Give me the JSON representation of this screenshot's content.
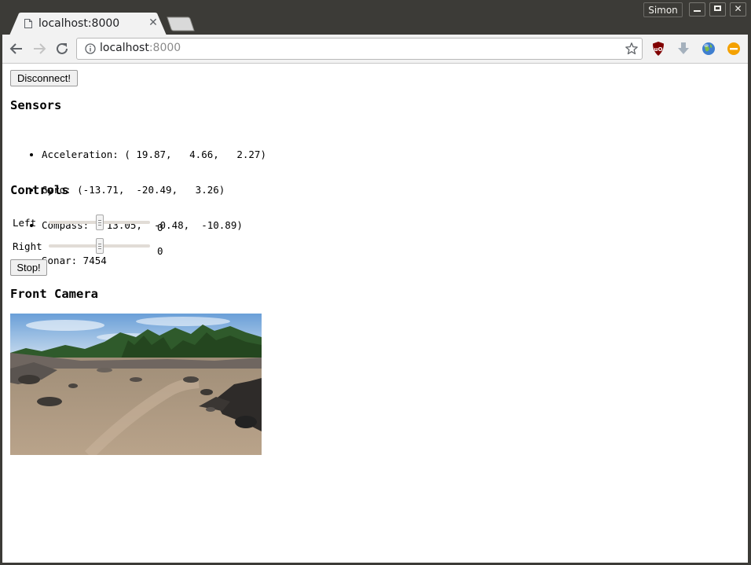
{
  "window": {
    "user_name": "Simon"
  },
  "tab": {
    "title": "localhost:8000"
  },
  "address_bar": {
    "host": "localhost",
    "port": ":8000"
  },
  "icons": {
    "tab_page": "page-icon",
    "tab_close": "close-icon",
    "back": "arrow-left-icon",
    "forward": "arrow-right-icon",
    "reload": "reload-icon",
    "site_info": "info-icon",
    "bookmark": "star-icon",
    "ublock": "ublock-shield-icon",
    "download": "download-arrow-icon",
    "globe": "globe-icon",
    "minus": "minus-circle-icon"
  },
  "page": {
    "disconnect_label": "Disconnect!",
    "sensors_heading": "Sensors",
    "sensors": [
      "Acceleration: ( 19.87,   4.66,   2.27)",
      "Gyro: (-13.71,  -20.49,   3.26)",
      "Compass: ( 13.05,  -0.48,  -10.89)",
      "Sonar: 7454"
    ],
    "controls_heading": "Controls",
    "controls": [
      {
        "label": "Left",
        "value": "0",
        "slider_fraction": 0.5
      },
      {
        "label": "Right",
        "value": "0",
        "slider_fraction": 0.5
      }
    ],
    "stop_label": "Stop!",
    "camera_heading": "Front Camera"
  },
  "colors": {
    "titlebar": "#3c3b37",
    "toolbar": "#f2f2f2",
    "accent_ublock": "#800000",
    "accent_minus": "#f4a100"
  }
}
